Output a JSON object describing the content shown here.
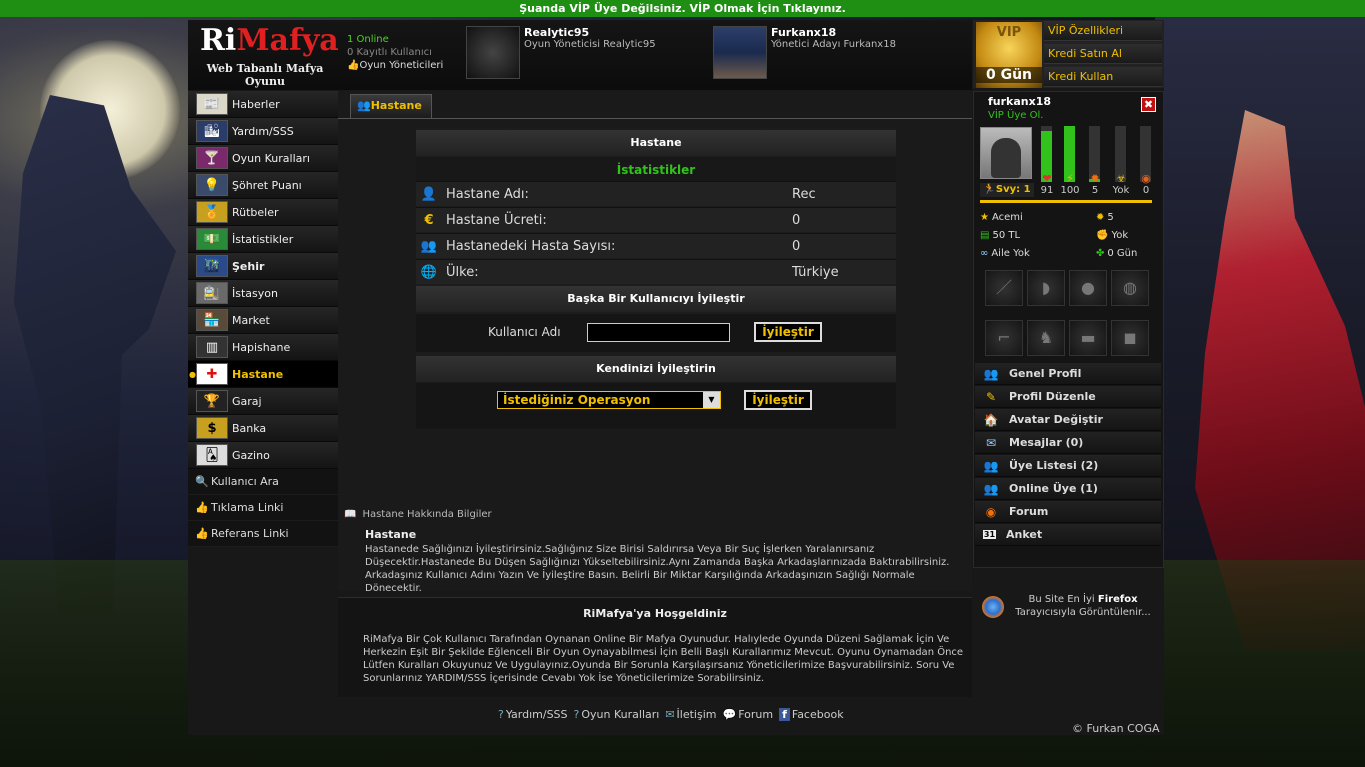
{
  "topbar": "Şuanda VİP Üye Değilsiniz. VİP Olmak İçin Tıklayınız.",
  "logo": {
    "part1": "Ri",
    "part2": "Mafya",
    "subtitle": "Web Tabanlı Mafya Oyunu"
  },
  "online": {
    "count": "1 Online",
    "registered": "0 Kayıtlı Kullanıcı",
    "admins": "Oyun Yöneticileri"
  },
  "staff": [
    {
      "name": "Realytic95",
      "role": "Oyun Yöneticisi Realytic95"
    },
    {
      "name": "Furkanx18",
      "role": "Yönetici Adayı Furkanx18"
    }
  ],
  "vip": {
    "badge": "VIP",
    "days": "0 Gün",
    "links": [
      "VİP Özellikleri",
      "Kredi Satın Al",
      "Kredi Kullan"
    ]
  },
  "nav": [
    {
      "label": "Haberler",
      "icon": "📰"
    },
    {
      "label": "Yardım/SSS",
      "icon": "🏙"
    },
    {
      "label": "Oyun Kuralları",
      "icon": "🍸"
    },
    {
      "label": "Şöhret Puanı",
      "icon": "💡"
    },
    {
      "label": "Rütbeler",
      "icon": "🏅"
    },
    {
      "label": "İstatistikler",
      "icon": "💵"
    },
    {
      "label": "Şehir",
      "icon": "🌃"
    },
    {
      "label": "İstasyon",
      "icon": "🚉"
    },
    {
      "label": "Market",
      "icon": "🏪"
    },
    {
      "label": "Hapishane",
      "icon": "▥"
    },
    {
      "label": "Hastane",
      "icon": "✚"
    },
    {
      "label": "Garaj",
      "icon": "🏆"
    },
    {
      "label": "Banka",
      "icon": "$"
    },
    {
      "label": "Gazino",
      "icon": "🂡"
    }
  ],
  "subnav": [
    {
      "label": "Kullanıcı Ara",
      "icon": "🔍"
    },
    {
      "label": "Tıklama Linki",
      "icon": "👍"
    },
    {
      "label": "Referans Linki",
      "icon": "👍"
    }
  ],
  "tab": "Hastane",
  "hospital": {
    "title": "Hastane",
    "stats_title": "İstatistikler",
    "rows": [
      {
        "label": "Hastane Adı:",
        "value": "Rec",
        "icon": "👤"
      },
      {
        "label": "Hastane Ücreti:",
        "value": "0",
        "icon": "€"
      },
      {
        "label": "Hastanedeki Hasta Sayısı:",
        "value": "0",
        "icon": "👥"
      },
      {
        "label": "Ülke:",
        "value": "Türkiye",
        "icon": "🌐"
      }
    ],
    "heal_other_title": "Başka Bir Kullanıcıyı İyileştir",
    "username_label": "Kullanıcı Adı",
    "username_value": "",
    "heal_button": "İyileştir",
    "heal_self_title": "Kendinizi İyileştirin",
    "operation_select": "İstediğiniz Operasyon",
    "heal_self_button": "İyileştir"
  },
  "info": {
    "header": "Hastane Hakkında Bilgiler",
    "title": "Hastane",
    "text": "Hastanede Sağlığınızı İyileştirirsiniz.Sağlığınız Size Birisi Saldırırsa Veya Bir Suç İşlerken Yaralanırsanız Düşecektir.Hastanede Bu Düşen Sağlığınızı Yükseltebilirsiniz.Aynı Zamanda Başka Arkadaşlarınızada Baktırabilirsiniz. Arkadaşınız Kullanıcı Adını Yazın Ve İyileştire Basın. Belirli Bir Miktar Karşılığında Arkadaşınızın Sağlığı Normale Dönecektir."
  },
  "welcome": {
    "title": "RiMafya'ya Hoşgeldiniz",
    "text": "RiMafya Bir Çok Kullanıcı Tarafından Oynanan Online Bir Mafya Oyunudur. Halıylede Oyunda Düzeni Sağlamak İçin Ve Herkezin Eşit Bir Şekilde Eğlenceli Bir Oyun Oynayabilmesi İçin Belli Başlı Kurallarımız Mevcut. Oyunu Oynamadan Önce Lütfen Kuralları Okuyunuz Ve Uygulayınız.Oyunda Bir Sorunla Karşılaşırsanız Yöneticilerimize Başvurabilirsiniz. Soru Ve Sorunlarınız YARDIM/SSS İçerisinde Cevabı Yok İse Yöneticilerimize Sorabilirsiniz."
  },
  "footer": [
    {
      "label": "Yardım/SSS",
      "icon": "?"
    },
    {
      "label": "Oyun Kuralları",
      "icon": "?"
    },
    {
      "label": "İletişim",
      "icon": "✉"
    },
    {
      "label": "Forum",
      "icon": "💬"
    },
    {
      "label": "Facebook",
      "icon": "f"
    }
  ],
  "copyright": "© Furkan COGA",
  "profile": {
    "name": "furkanx18",
    "vip_cta": "VİP Üye Ol.",
    "close": "✖",
    "level": "Svy: 1",
    "bars": [
      {
        "icon": "❤",
        "value": "91",
        "fill": 0.91,
        "color": "#e03030"
      },
      {
        "icon": "⚡",
        "value": "100",
        "fill": 1.0,
        "color": "#f0c000"
      },
      {
        "icon": "✹",
        "value": "5",
        "fill": 0.05,
        "color": "#f07010"
      },
      {
        "icon": "☣",
        "value": "Yok",
        "fill": 0,
        "color": "#f0c000"
      },
      {
        "icon": "◉",
        "value": "0",
        "fill": 0,
        "color": "#e06020"
      }
    ],
    "stats_left": [
      {
        "icon": "★",
        "text": "Acemi"
      },
      {
        "icon": "▤",
        "text": "50 TL"
      },
      {
        "icon": "∞",
        "text": "Aile Yok"
      }
    ],
    "stats_right": [
      {
        "icon": "✹",
        "text": "5"
      },
      {
        "icon": "✊",
        "text": "Yok"
      },
      {
        "icon": "✤",
        "text": "0 Gün"
      }
    ],
    "slots": [
      "knife",
      "helmet",
      "bomb",
      "grenade",
      "pistol",
      "dog",
      "car",
      "vest"
    ],
    "menu": [
      {
        "label": "Genel Profil",
        "icon": "👥"
      },
      {
        "label": "Profil Düzenle",
        "icon": "✎"
      },
      {
        "label": "Avatar Değiştir",
        "icon": "🏠"
      },
      {
        "label": "Mesajlar (0)",
        "icon": "✉"
      },
      {
        "label": "Üye Listesi (2)",
        "icon": "👥"
      },
      {
        "label": "Online Üye (1)",
        "icon": "👥"
      },
      {
        "label": "Forum",
        "icon": "◉"
      },
      {
        "label": "Anket",
        "icon": "31"
      }
    ]
  },
  "firefox": {
    "line1": "Bu Site En İyi",
    "brand": "Firefox",
    "line2": "Tarayıcısıyla Görüntülenir..."
  }
}
